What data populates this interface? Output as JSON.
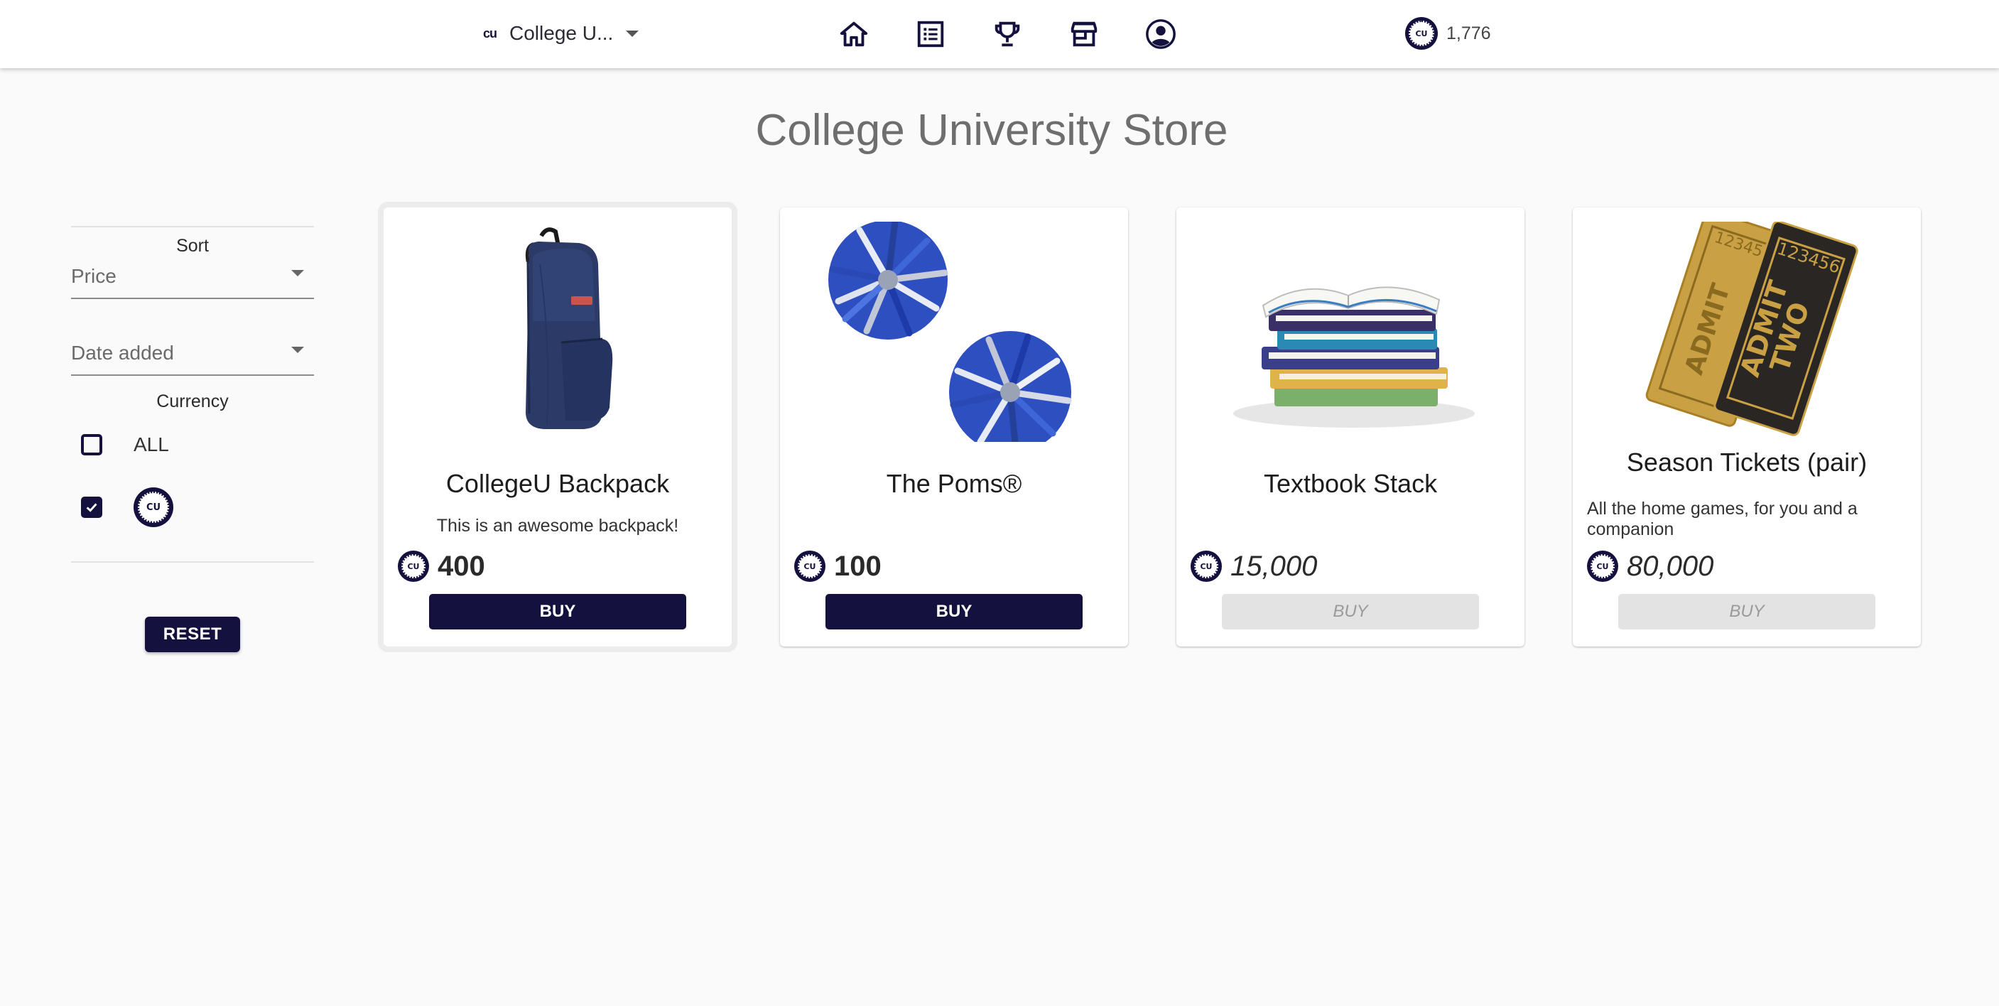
{
  "header": {
    "org_logo_text": "cu",
    "org_name": "College U...",
    "nav": [
      {
        "icon": "home-icon"
      },
      {
        "icon": "list-icon"
      },
      {
        "icon": "trophy-icon"
      },
      {
        "icon": "store-icon"
      },
      {
        "icon": "account-icon"
      }
    ],
    "balance": "1,776",
    "coin_text": "CU"
  },
  "page_title": "College University Store",
  "sidebar": {
    "sort_label": "Sort",
    "sort_price": "Price",
    "sort_date": "Date added",
    "currency_label": "Currency",
    "currency_options": [
      {
        "label": "ALL",
        "checked": false
      },
      {
        "label": "",
        "checked": true,
        "icon": "cu-coin-icon"
      }
    ],
    "reset_label": "RESET"
  },
  "products": [
    {
      "title": "CollegeU Backpack",
      "description": "This is an awesome backpack!",
      "price": "400",
      "buy_label": "BUY",
      "affordable": true,
      "image": "backpack"
    },
    {
      "title": "The Poms®",
      "description": "",
      "price": "100",
      "buy_label": "BUY",
      "affordable": true,
      "image": "pompoms"
    },
    {
      "title": "Textbook Stack",
      "description": "",
      "price": "15,000",
      "buy_label": "BUY",
      "affordable": false,
      "image": "books"
    },
    {
      "title": "Season Tickets (pair)",
      "description": "All the home games, for you and a companion",
      "price": "80,000",
      "buy_label": "BUY",
      "affordable": false,
      "image": "tickets"
    }
  ],
  "ticket_text": {
    "admit": "ADMIT",
    "two": "TWO",
    "number": "123456"
  },
  "colors": {
    "brand": "#14113f",
    "background": "#fafafa",
    "disabled": "#e3e3e3"
  }
}
